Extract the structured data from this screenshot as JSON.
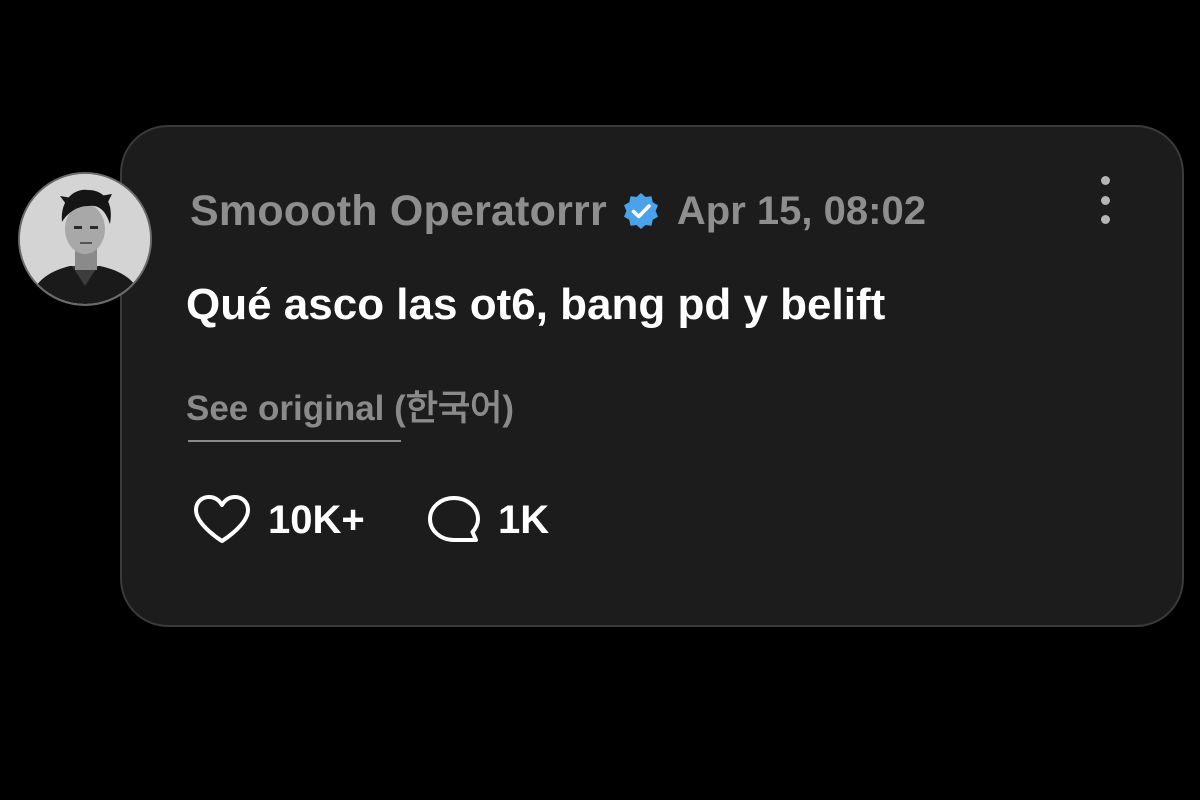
{
  "post": {
    "username": "Smoooth Operatorrr",
    "verified": true,
    "timestamp": "Apr 15, 08:02",
    "text": "Qué asco las ot6, bang pd y belift",
    "translation_link": "See original (한국어)",
    "likes": "10K+",
    "replies": "1K"
  },
  "icons": {
    "avatar": "profile-photo",
    "verified": "verified-badge-icon",
    "more": "more-vertical-icon",
    "like": "heart-icon",
    "reply": "speech-bubble-icon"
  },
  "colors": {
    "background": "#000000",
    "card": "#1c1c1c",
    "card_border": "#3a3a3a",
    "muted_text": "#8e8e8e",
    "primary_text": "#ffffff",
    "verified_blue": "#4aa3ea"
  }
}
